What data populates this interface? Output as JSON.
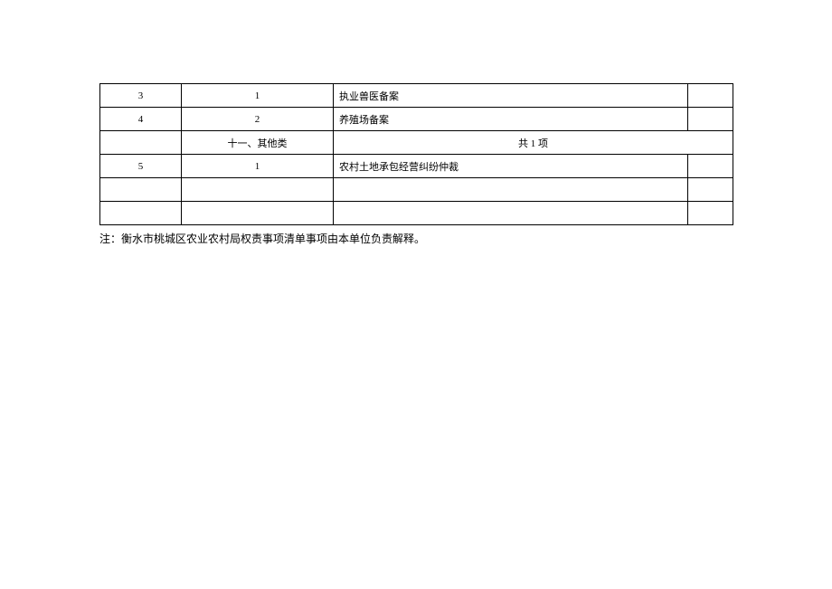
{
  "table": {
    "rows": [
      {
        "c1": "3",
        "c2": "1",
        "c3": "执业兽医备案",
        "c4": ""
      },
      {
        "c1": "4",
        "c2": "2",
        "c3": "养殖场备案",
        "c4": ""
      }
    ],
    "section_row": {
      "c1": "",
      "c2": "十一、其他类",
      "merged": "共 1 项"
    },
    "after_section_rows": [
      {
        "c1": "5",
        "c2": "1",
        "c3": "农村土地承包经营纠纷仲裁",
        "c4": ""
      },
      {
        "c1": "",
        "c2": "",
        "c3": "",
        "c4": ""
      },
      {
        "c1": "",
        "c2": "",
        "c3": "",
        "c4": ""
      }
    ]
  },
  "note": "注：衡水市桃城区农业农村局权责事项清单事项由本单位负责解释。"
}
